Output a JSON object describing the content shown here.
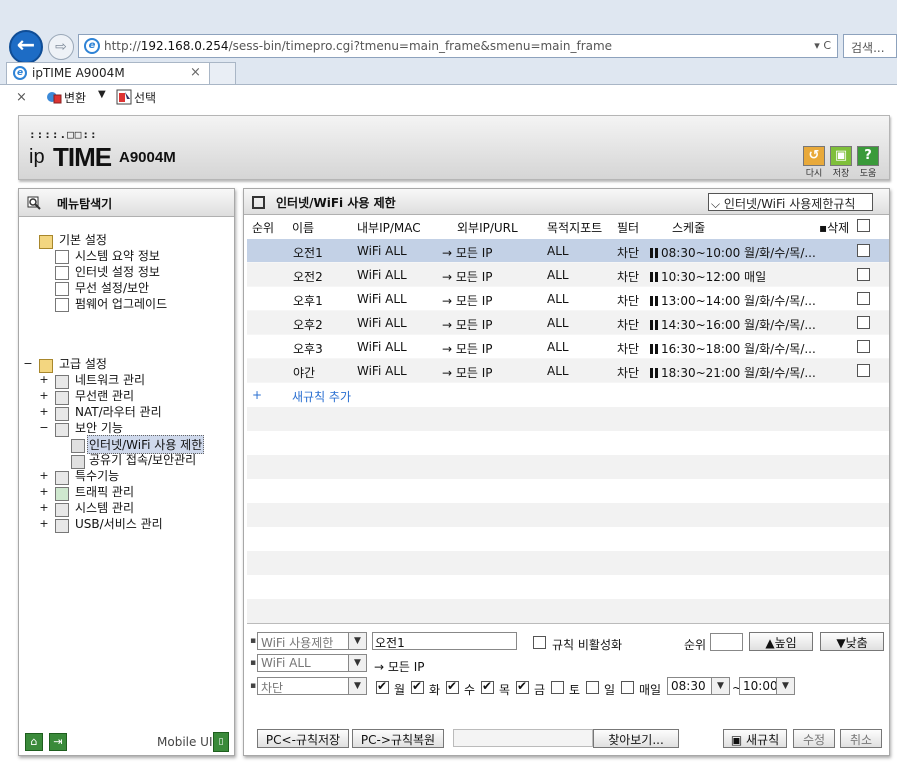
{
  "browser": {
    "url_prefix": "http://",
    "url_host": "192.168.0.254",
    "url_path": "/sess-bin/timepro.cgi?tmenu=main_frame&smenu=main_frame",
    "url_controls": "▾ C",
    "search_placeholder": "검색...",
    "tab_title": "ipTIME A9004M",
    "tab_close": "×",
    "cmd_close": "×",
    "cmd_convert": "변환",
    "cmd_select": "선택"
  },
  "header": {
    "logo_dots": "::::.□□::",
    "logo_ip": "ip",
    "logo_time": "TIME",
    "logo_model": "A9004M",
    "buttons": [
      {
        "label": "다시",
        "icon": "↺",
        "color": "#e8a93a"
      },
      {
        "label": "저장",
        "icon": "▣",
        "color": "#7fbf3a"
      },
      {
        "label": "도움",
        "icon": "?",
        "color": "#3a9a3a"
      }
    ]
  },
  "sidebar": {
    "title": "메뉴탐색기",
    "basic": {
      "label": "기본 설정",
      "items": [
        "시스템 요약 정보",
        "인터넷 설정 정보",
        "무선 설정/보안",
        "펌웨어 업그레이드"
      ]
    },
    "advanced": {
      "toggle": "−",
      "label": "고급 설정",
      "items": [
        {
          "toggle": "+",
          "label": "네트워크 관리"
        },
        {
          "toggle": "+",
          "label": "무선랜 관리"
        },
        {
          "toggle": "+",
          "label": "NAT/라우터 관리"
        },
        {
          "toggle": "−",
          "label": "보안 기능"
        },
        {
          "toggle": "+",
          "label": "특수기능"
        },
        {
          "toggle": "+",
          "label": "트래픽 관리"
        },
        {
          "toggle": "+",
          "label": "시스템 관리"
        },
        {
          "toggle": "+",
          "label": "USB/서비스 관리"
        }
      ],
      "security_children": [
        "인터넷/WiFi 사용 제한",
        "공유기 접속/보안관리"
      ]
    },
    "footer_mobile": "Mobile UI"
  },
  "main": {
    "title": "인터넷/WiFi 사용 제한",
    "view_select": "인터넷/WiFi 사용제한규칙",
    "columns": {
      "order": "순위",
      "name": "이름",
      "inner": "내부IP/MAC",
      "outer": "외부IP/URL",
      "port": "목적지포트",
      "filter": "필터",
      "schedule": "스케줄",
      "delete": "삭제"
    },
    "rules": [
      {
        "name": "오전1",
        "inner": "WiFi ALL",
        "outer": "→ 모든 IP",
        "port": "ALL",
        "filter": "차단",
        "schedule": "08:30~10:00 월/화/수/목/...",
        "selected": true
      },
      {
        "name": "오전2",
        "inner": "WiFi ALL",
        "outer": "→ 모든 IP",
        "port": "ALL",
        "filter": "차단",
        "schedule": "10:30~12:00 매일",
        "selected": false
      },
      {
        "name": "오후1",
        "inner": "WiFi ALL",
        "outer": "→ 모든 IP",
        "port": "ALL",
        "filter": "차단",
        "schedule": "13:00~14:00 월/화/수/목/...",
        "selected": false
      },
      {
        "name": "오후2",
        "inner": "WiFi ALL",
        "outer": "→ 모든 IP",
        "port": "ALL",
        "filter": "차단",
        "schedule": "14:30~16:00 월/화/수/목/...",
        "selected": false
      },
      {
        "name": "오후3",
        "inner": "WiFi ALL",
        "outer": "→ 모든 IP",
        "port": "ALL",
        "filter": "차단",
        "schedule": "16:30~18:00 월/화/수/목/...",
        "selected": false
      },
      {
        "name": "야간",
        "inner": "WiFi ALL",
        "outer": "→ 모든 IP",
        "port": "ALL",
        "filter": "차단",
        "schedule": "18:30~21:00 월/화/수/목/...",
        "selected": false
      }
    ],
    "add_rule": {
      "plus": "+",
      "label": "새규칙 추가"
    },
    "editor": {
      "type_select": "WiFi 사용제한",
      "name_value": "오전1",
      "disable_label": "규칙 비활성화",
      "order_label": "순위",
      "up_label": "▲높임",
      "down_label": "▼낮춤",
      "inner_select": "WiFi ALL",
      "outer_text": "→ 모든 IP",
      "filter_select": "차단",
      "days": [
        {
          "label": "월",
          "checked": true
        },
        {
          "label": "화",
          "checked": true
        },
        {
          "label": "수",
          "checked": true
        },
        {
          "label": "목",
          "checked": true
        },
        {
          "label": "금",
          "checked": true
        },
        {
          "label": "토",
          "checked": false
        },
        {
          "label": "일",
          "checked": false
        },
        {
          "label": "매일",
          "checked": false
        }
      ],
      "start_time": "08:30",
      "tilde": "~",
      "end_time": "10:00"
    },
    "footer": {
      "pc_save": "PC<-규칙저장",
      "pc_restore": "PC->규칙복원",
      "browse": "찾아보기...",
      "new_rule": "새규칙",
      "modify": "수정",
      "cancel": "취소"
    }
  }
}
